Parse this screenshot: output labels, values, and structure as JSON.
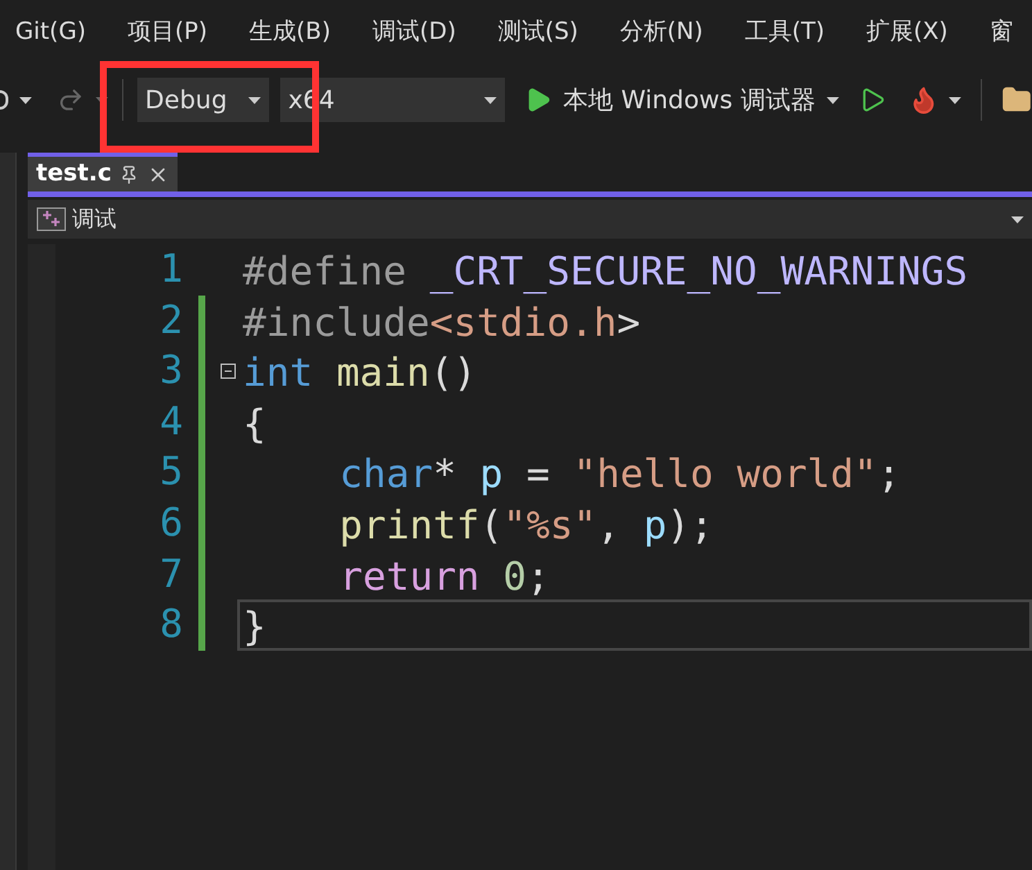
{
  "menu_bar": [
    "Git(G)",
    "项目(P)",
    "生成(B)",
    "调试(D)",
    "测试(S)",
    "分析(N)",
    "工具(T)",
    "扩展(X)",
    "窗"
  ],
  "toolbar": {
    "configuration": "Debug",
    "platform": "x64",
    "run_target": "本地 Windows 调试器"
  },
  "tabs": [
    {
      "label": "test.c",
      "selected": true
    }
  ],
  "navigation_bar": {
    "scope": "调试"
  },
  "editor": {
    "lines": [
      {
        "number": "1",
        "changed": false,
        "foldable": false,
        "current": false,
        "tokens": [
          {
            "kind": "preproc",
            "text": "#define "
          },
          {
            "kind": "macro",
            "text": "_CRT_SECURE_NO_WARNINGS"
          }
        ]
      },
      {
        "number": "2",
        "changed": true,
        "foldable": false,
        "current": false,
        "tokens": [
          {
            "kind": "preproc",
            "text": "#include"
          },
          {
            "kind": "string",
            "text": "<stdio.h"
          },
          {
            "kind": "plain",
            "text": ">"
          }
        ]
      },
      {
        "number": "3",
        "changed": true,
        "foldable": true,
        "current": false,
        "tokens": [
          {
            "kind": "keyword",
            "text": "int "
          },
          {
            "kind": "func",
            "text": "main"
          },
          {
            "kind": "plain",
            "text": "()"
          }
        ]
      },
      {
        "number": "4",
        "changed": true,
        "foldable": false,
        "current": false,
        "tokens": [
          {
            "kind": "plain",
            "text": "{"
          }
        ]
      },
      {
        "number": "5",
        "changed": true,
        "foldable": false,
        "current": false,
        "indented": true,
        "tokens": [
          {
            "kind": "keyword",
            "text": "char"
          },
          {
            "kind": "plain",
            "text": "* "
          },
          {
            "kind": "var",
            "text": "p"
          },
          {
            "kind": "plain",
            "text": " = "
          },
          {
            "kind": "string",
            "text": "\"hello world\""
          },
          {
            "kind": "plain",
            "text": ";"
          }
        ]
      },
      {
        "number": "6",
        "changed": true,
        "foldable": false,
        "current": false,
        "indented": true,
        "tokens": [
          {
            "kind": "func",
            "text": "printf"
          },
          {
            "kind": "plain",
            "text": "("
          },
          {
            "kind": "string",
            "text": "\"%s\""
          },
          {
            "kind": "plain",
            "text": ", "
          },
          {
            "kind": "var",
            "text": "p"
          },
          {
            "kind": "plain",
            "text": ");"
          }
        ]
      },
      {
        "number": "7",
        "changed": true,
        "foldable": false,
        "current": false,
        "indented": true,
        "tokens": [
          {
            "kind": "control",
            "text": "return "
          },
          {
            "kind": "number",
            "text": "0"
          },
          {
            "kind": "plain",
            "text": ";"
          }
        ]
      },
      {
        "number": "8",
        "changed": true,
        "foldable": false,
        "current": true,
        "tokens": [
          {
            "kind": "plain",
            "text": "}"
          }
        ]
      }
    ]
  }
}
